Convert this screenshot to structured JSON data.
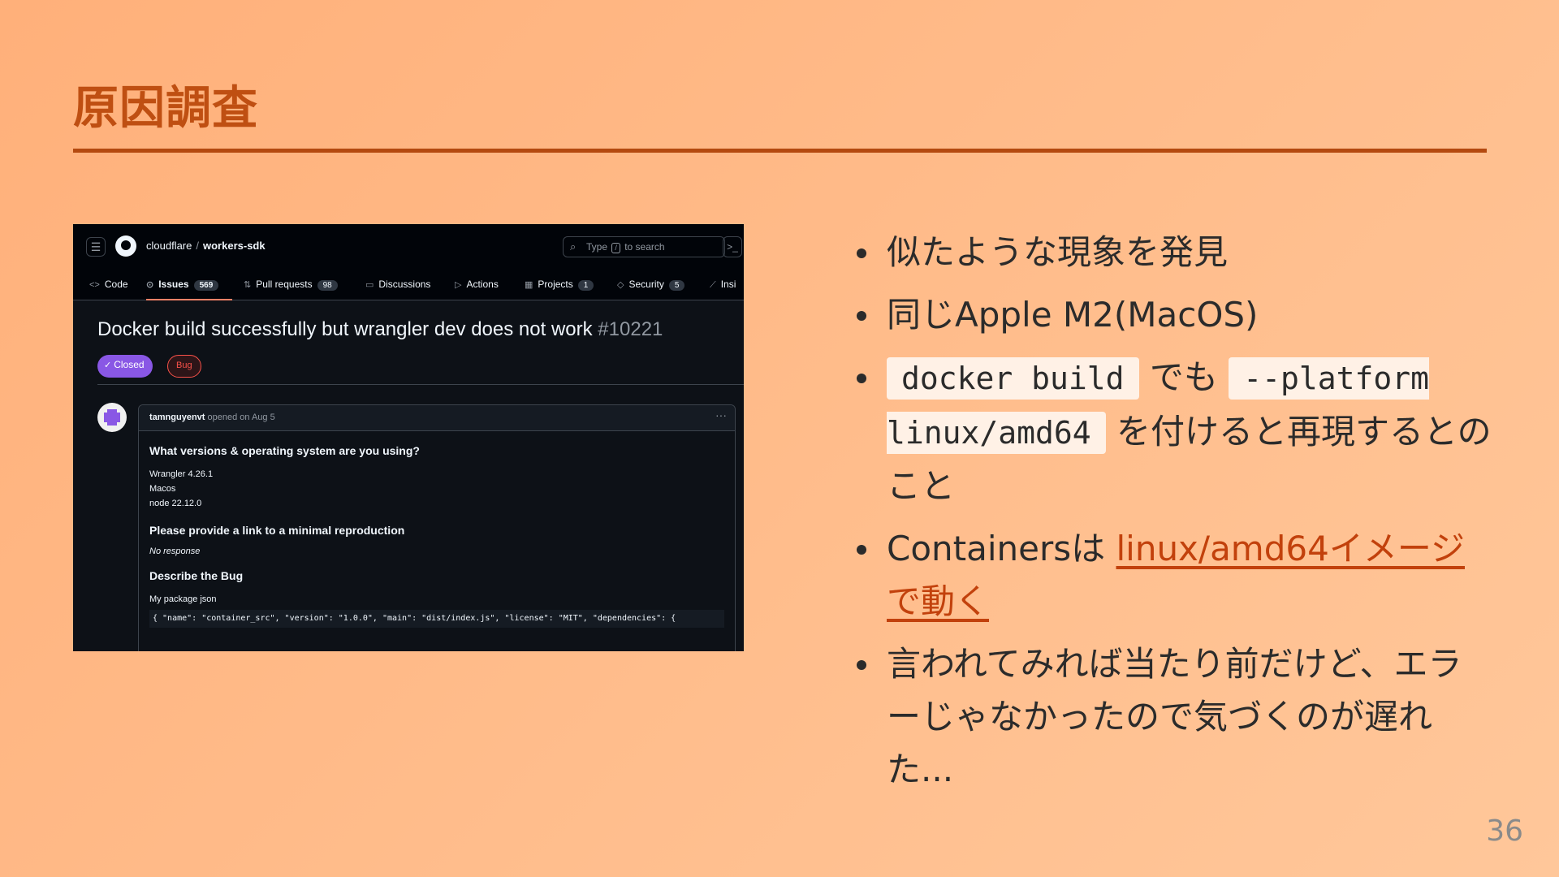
{
  "slide": {
    "title": "原因調査",
    "page_number": "36"
  },
  "screenshot": {
    "repo_owner": "cloudflare",
    "repo_separator": "/",
    "repo_name": "workers-sdk",
    "search": {
      "before": "Type",
      "key": "/",
      "after": "to search"
    },
    "tabs": [
      {
        "label": "Code"
      },
      {
        "label": "Issues",
        "count": "569"
      },
      {
        "label": "Pull requests",
        "count": "98"
      },
      {
        "label": "Discussions"
      },
      {
        "label": "Actions"
      },
      {
        "label": "Projects",
        "count": "1"
      },
      {
        "label": "Security",
        "count": "5"
      },
      {
        "label": "Insi"
      }
    ],
    "issue": {
      "title": "Docker build successfully but wrangler dev does not work",
      "number": "#10221",
      "state": "Closed",
      "label": "Bug"
    },
    "comment": {
      "author": "tamnguyenvt",
      "meta": "opened on Aug 5",
      "heading1": "What versions & operating system are you using?",
      "line1": "Wrangler 4.26.1",
      "line2": "Macos",
      "line3": "node 22.12.0",
      "heading2": "Please provide a link to a minimal reproduction",
      "no_response": "No response",
      "heading3": "Describe the Bug",
      "line4": "My package json",
      "code": "{ \"name\": \"container_src\", \"version\": \"1.0.0\", \"main\": \"dist/index.js\", \"license\": \"MIT\", \"dependencies\": {"
    }
  },
  "bullets": {
    "b1": "似たような現象を発見",
    "b2": "同じApple M2(MacOS)",
    "b3_code1": "docker build",
    "b3_text1": " でも ",
    "b3_code2": "--platform linux/amd64",
    "b3_text2": " を付けると再現するとのこと",
    "b4_text": "Containersは ",
    "b4_link": "linux/amd64イメージで動く",
    "b5": "言われてみれば当たり前だけど、エラーじゃなかったので気づくのが遅れた..."
  },
  "colors": {
    "title": "#bf4f12",
    "rule": "#b4490f",
    "link": "#c2410c",
    "closed_badge": "#8957e5",
    "bug_label": "#f85149"
  },
  "icons": [
    "hamburger-menu-icon",
    "github-logo-icon",
    "search-icon",
    "command-palette-icon",
    "code-icon",
    "issue-icon",
    "pull-request-icon",
    "discussion-icon",
    "actions-icon",
    "projects-icon",
    "shield-icon",
    "graph-icon",
    "check-circle-icon",
    "kebab-icon"
  ]
}
